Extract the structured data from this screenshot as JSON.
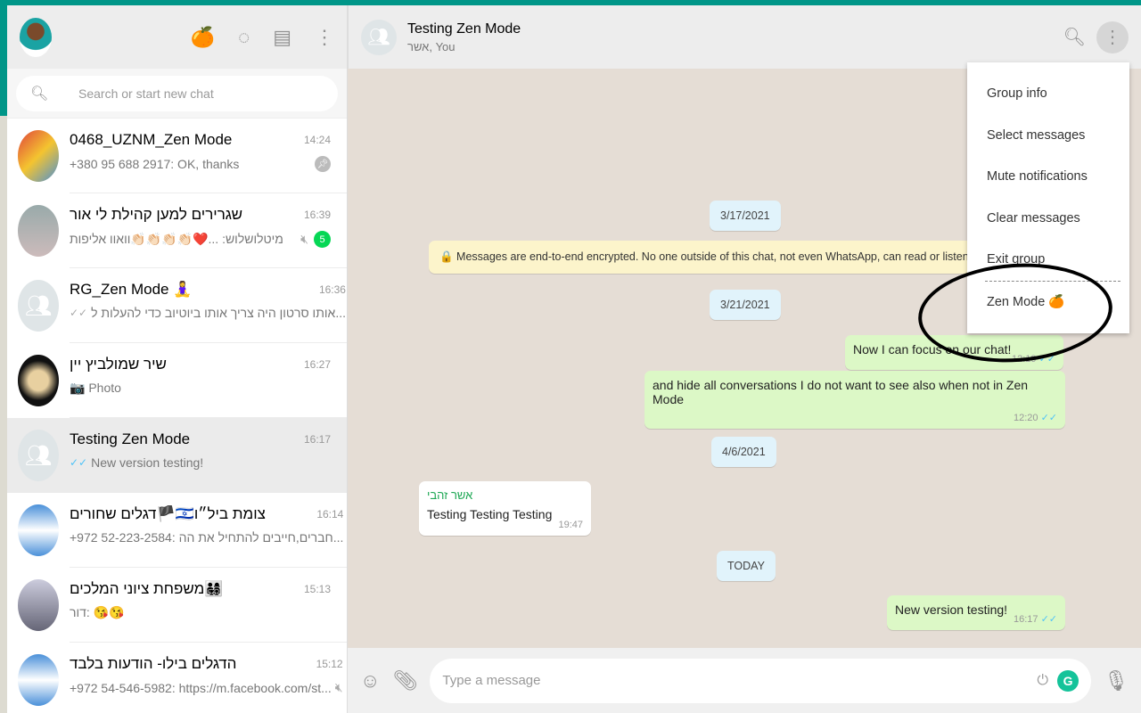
{
  "sidebar": {
    "header": {
      "icons": [
        "zen-mode-icon",
        "status-icon",
        "new-chat-icon",
        "menu-icon"
      ]
    },
    "search": {
      "placeholder": "Search or start new chat"
    },
    "chats": [
      {
        "name": "0468_UZNM_Zen Mode",
        "time": "14:24",
        "preview": "+380 95 688 2917: OK, thanks",
        "pinned": true
      },
      {
        "name": "שגרירים למען קהילת לי אור",
        "time": "16:39",
        "preview": "מיטלושלוש:   ...❤️👏🏻👏🏻👏🏻👏🏻וואוו אליפות",
        "muted": true,
        "unread": "5"
      },
      {
        "name": "RG_Zen Mode 🧘‍♀️",
        "time": "16:36",
        "preview": "אותו סרטון היה צריך אותו ביוטיוב כדי להעלות ל...",
        "group": true,
        "ticks": "✓✓"
      },
      {
        "name": "שיר שמולביץ יין",
        "time": "16:27",
        "preview": "📷 Photo"
      },
      {
        "name": "Testing Zen Mode",
        "time": "16:17",
        "preview": "New version testing!",
        "group": true,
        "ticks": "✓✓",
        "selected": true
      },
      {
        "name": "דגלים שחורים🏴🇮🇱צומת ביל״ו",
        "time": "16:14",
        "preview": "+972 52-223-2584: חברים,חייבים להתחיל את הה..."
      },
      {
        "name": "משפחת ציוני המלכים👨‍👩‍👧‍👦",
        "time": "15:13",
        "preview": "דור: 😘😘"
      },
      {
        "name": "הדגלים בילו- הודעות בלבד",
        "time": "15:12",
        "preview": "+972 54-546-5982: https://m.facebook.com/st...",
        "muted": true
      }
    ]
  },
  "chat": {
    "title": "Testing Zen Mode",
    "subtitle": "אשר, You",
    "dates": [
      "3/17/2021",
      "3/21/2021",
      "4/6/2021",
      "TODAY"
    ],
    "encryption": "🔒 Messages are end-to-end encrypted. No one outside of this chat, not even WhatsApp, can read or listen to them. Click to learn more.",
    "messages": [
      {
        "text": "Now I can focus on our chat!",
        "time": "12:19",
        "ticks": "✓✓"
      },
      {
        "text": "and hide all conversations I do not want to see also when not in Zen Mode",
        "time": "12:20",
        "ticks": "✓✓"
      },
      {
        "sender": "אשר זהבי",
        "text": "Testing Testing Testing",
        "time": "19:47"
      },
      {
        "text": "New version testing!",
        "time": "16:17",
        "ticks": "✓✓"
      }
    ],
    "composer": {
      "placeholder": "Type a message"
    }
  },
  "menu": {
    "items": [
      "Group info",
      "Select messages",
      "Mute notifications",
      "Clear messages",
      "Exit group",
      "Zen Mode 🍊"
    ],
    "highlighted": "Zen Mode"
  },
  "colors": {
    "accent": "#009688",
    "outgoing": "#dcf8c6",
    "unread": "#06d755",
    "tick": "#4fc3f7"
  }
}
